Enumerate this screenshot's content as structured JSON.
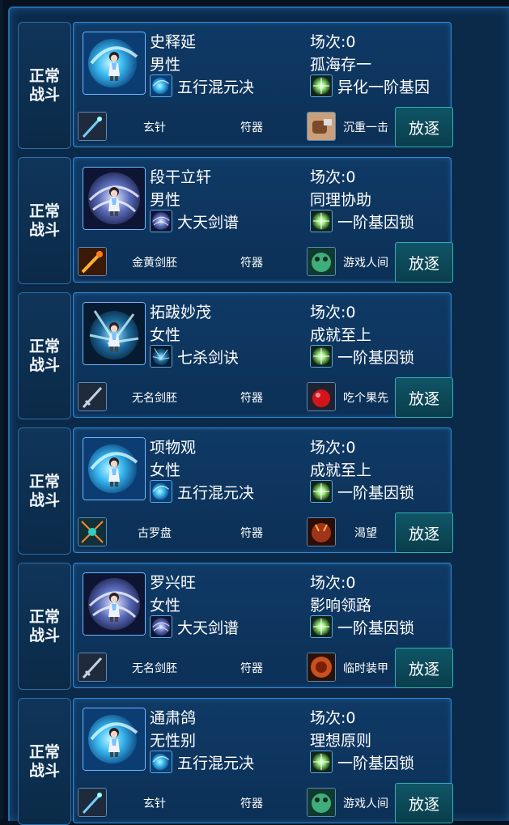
{
  "labels": {
    "mode": "正常战斗",
    "talisman": "符器",
    "expel": "放逐"
  },
  "colors": {
    "panel": "#0b2a4a",
    "border": "#2f8ad6",
    "button": "#0f5566"
  },
  "members": [
    {
      "name": "史释延",
      "gender": "男性",
      "skill": "五行混元决",
      "skill_icon": "water-orb-icon",
      "matches": "场次:0",
      "trait": "孤海存一",
      "gene": "异化一阶基因",
      "weapon": "玄针",
      "weapon_icon": "needle-icon",
      "item": "沉重一击",
      "item_icon": "fist-icon"
    },
    {
      "name": "段干立轩",
      "gender": "男性",
      "skill": "大天剑谱",
      "skill_icon": "swirl-icon",
      "matches": "场次:0",
      "trait": "同理协助",
      "gene": "一阶基因锁",
      "weapon": "金黄剑胚",
      "weapon_icon": "golden-sword-icon",
      "item": "游戏人间",
      "item_icon": "frog-icon"
    },
    {
      "name": "拓跋妙茂",
      "gender": "女性",
      "skill": "七杀剑诀",
      "skill_icon": "blade-storm-icon",
      "matches": "场次:0",
      "trait": "成就至上",
      "gene": "一阶基因锁",
      "weapon": "无名剑胚",
      "weapon_icon": "sword-icon",
      "item": "吃个果先",
      "item_icon": "apple-icon"
    },
    {
      "name": "项物观",
      "gender": "女性",
      "skill": "五行混元决",
      "skill_icon": "water-orb-icon",
      "matches": "场次:0",
      "trait": "成就至上",
      "gene": "一阶基因锁",
      "weapon": "古罗盘",
      "weapon_icon": "compass-icon",
      "item": "渴望",
      "item_icon": "demon-icon"
    },
    {
      "name": "罗兴旺",
      "gender": "女性",
      "skill": "大天剑谱",
      "skill_icon": "swirl-icon",
      "matches": "场次:0",
      "trait": "影响领路",
      "gene": "一阶基因锁",
      "weapon": "无名剑胚",
      "weapon_icon": "sword-icon",
      "item": "临时装甲",
      "item_icon": "armor-icon"
    },
    {
      "name": "通肃鸽",
      "gender": "无性别",
      "skill": "五行混元决",
      "skill_icon": "water-orb-icon",
      "matches": "场次:0",
      "trait": "理想原则",
      "gene": "一阶基因锁",
      "weapon": "玄针",
      "weapon_icon": "needle-icon",
      "item": "游戏人间",
      "item_icon": "frog-icon"
    }
  ]
}
